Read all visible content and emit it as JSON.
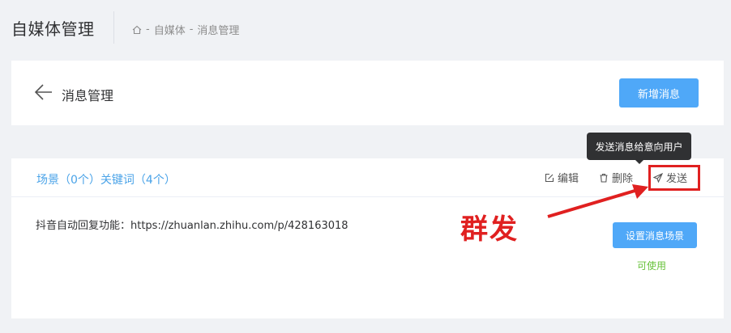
{
  "app": {
    "title": "自媒体管理"
  },
  "breadcrumb": {
    "items": [
      "自媒体",
      "消息管理"
    ],
    "separator": "-"
  },
  "header": {
    "title": "消息管理",
    "add_button": "新增消息"
  },
  "scene": {
    "title": "场景（0个）关键词（4个）",
    "actions": {
      "edit": "编辑",
      "delete": "删除",
      "send": "发送"
    },
    "text": "抖音自动回复功能：https://zhuanlan.zhihu.com/p/428163018",
    "setup_button": "设置消息场景",
    "status": "可使用"
  },
  "tooltip": {
    "text": "发送消息给意向用户"
  },
  "annotation": {
    "label": "群发"
  },
  "colors": {
    "primary": "#4fa8f8",
    "link": "#4aa3e8",
    "success": "#67c23a",
    "annotation": "#e02020"
  }
}
